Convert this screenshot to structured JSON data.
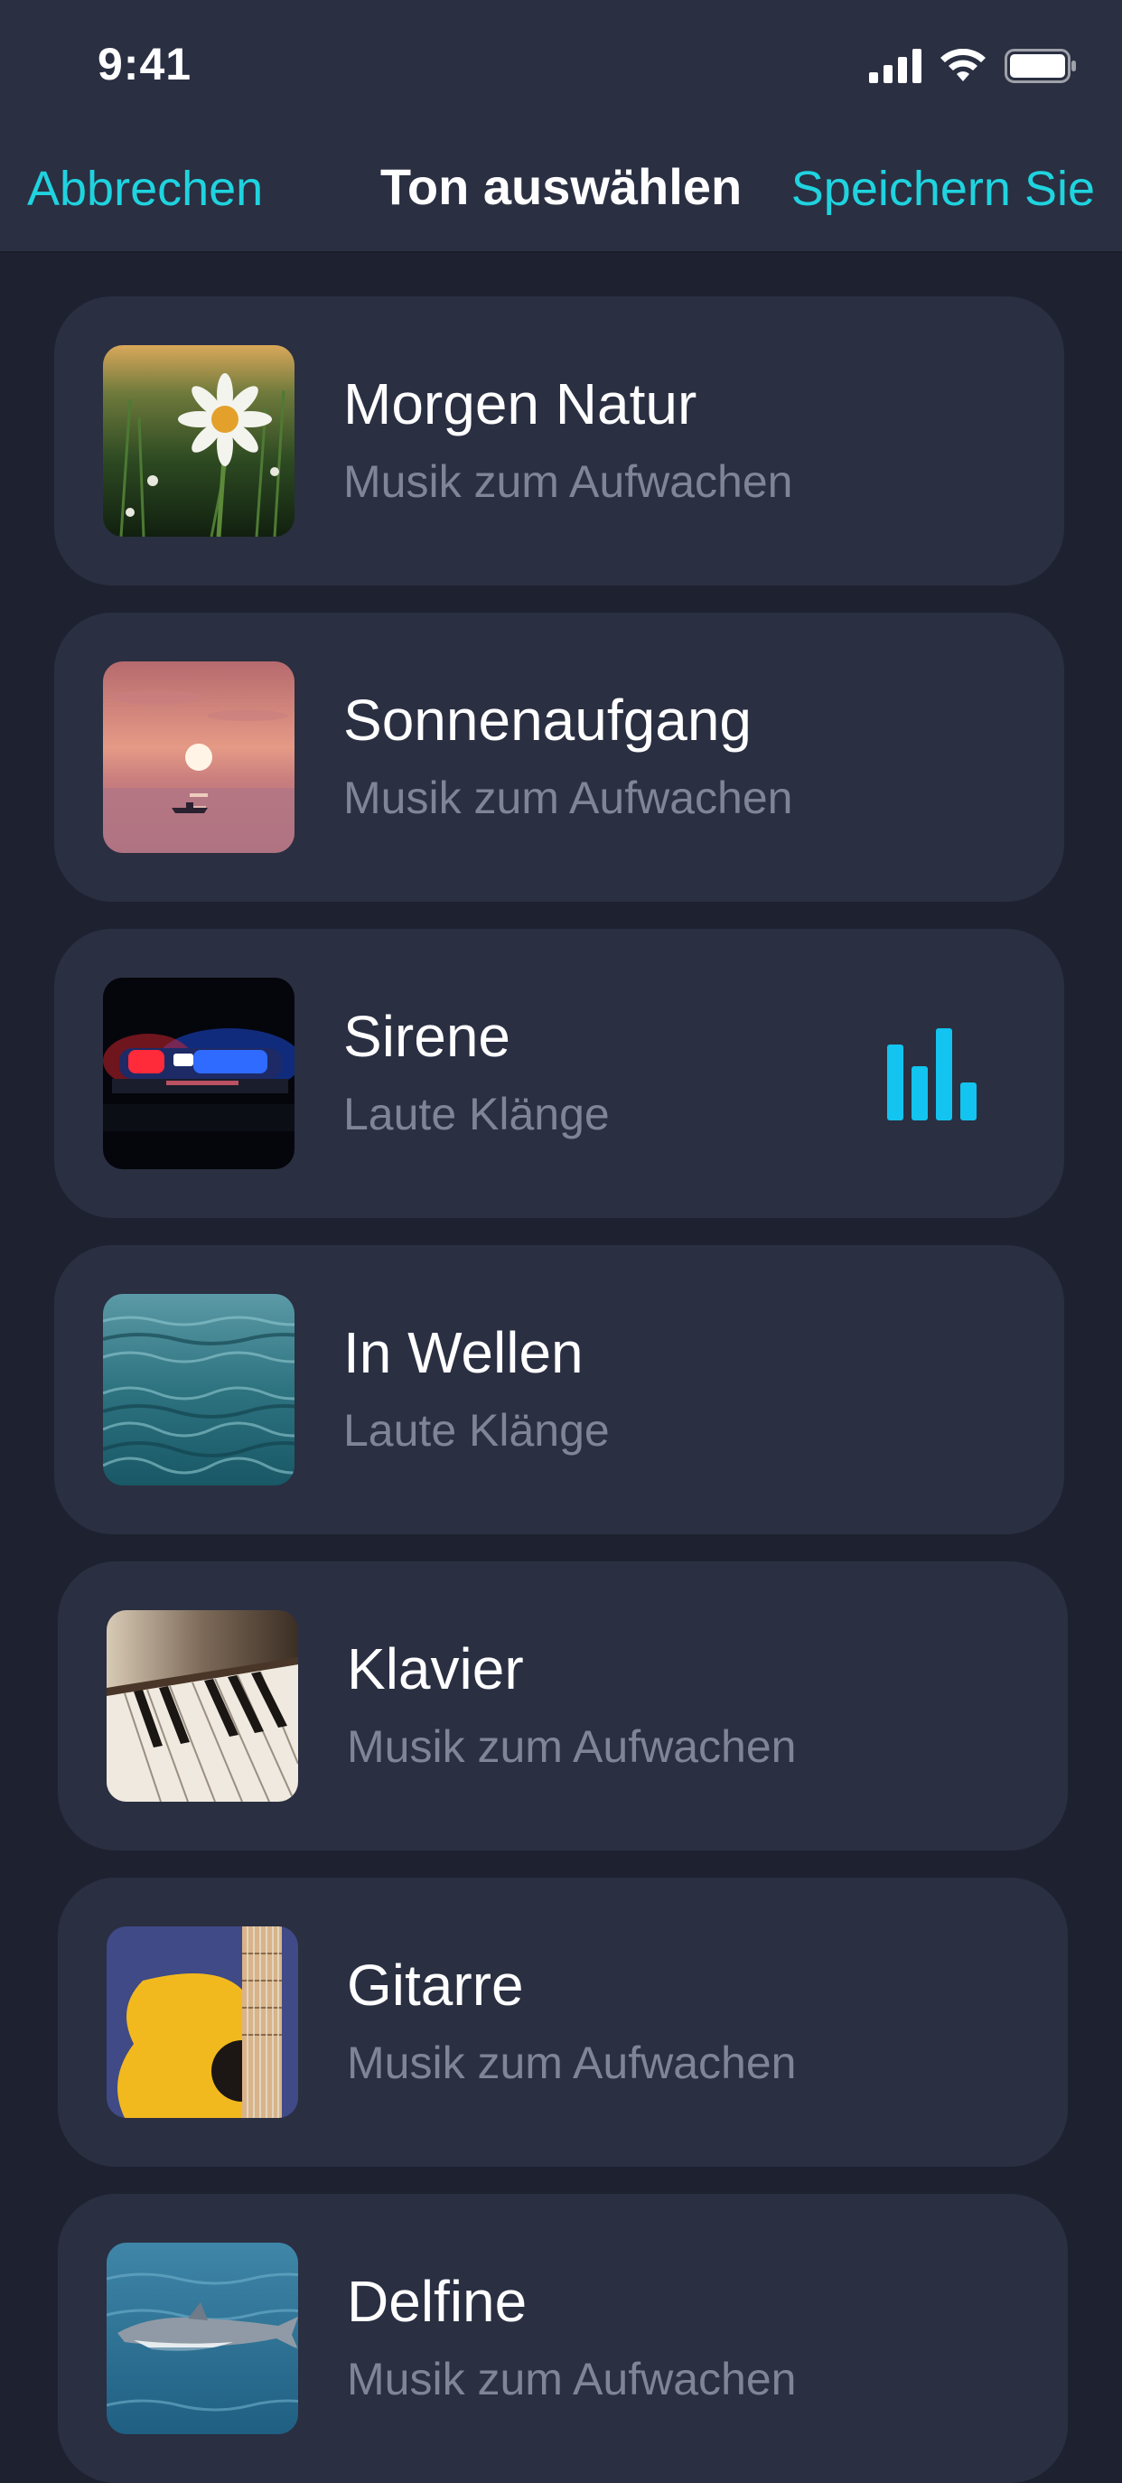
{
  "status_bar": {
    "time": "9:41",
    "icons": [
      "cellular-signal-icon",
      "wifi-icon",
      "battery-icon"
    ]
  },
  "nav": {
    "cancel_label": "Abbrechen",
    "title": "Ton auswählen",
    "save_label": "Speichern Sie"
  },
  "colors": {
    "accent": "#1fd3df",
    "playing_indicator": "#12c4ef",
    "background": "#1e2230",
    "card": "#2a2f42",
    "subtitle": "#7f8496"
  },
  "sounds": [
    {
      "title": "Morgen Natur",
      "subtitle": "Musik zum Aufwachen",
      "image": "daisy-field-image",
      "playing": false
    },
    {
      "title": "Sonnenaufgang",
      "subtitle": "Musik zum Aufwachen",
      "image": "sunrise-sea-image",
      "playing": false
    },
    {
      "title": "Sirene",
      "subtitle": "Laute Klänge",
      "image": "police-siren-image",
      "playing": true
    },
    {
      "title": "In Wellen",
      "subtitle": "Laute Klänge",
      "image": "sea-waves-image",
      "playing": false
    },
    {
      "title": "Klavier",
      "subtitle": "Musik zum Aufwachen",
      "image": "piano-keys-image",
      "playing": false
    },
    {
      "title": "Gitarre",
      "subtitle": "Musik zum Aufwachen",
      "image": "guitar-image",
      "playing": false
    },
    {
      "title": "Delfine",
      "subtitle": "Musik zum Aufwachen",
      "image": "dolphin-image",
      "playing": false
    }
  ]
}
